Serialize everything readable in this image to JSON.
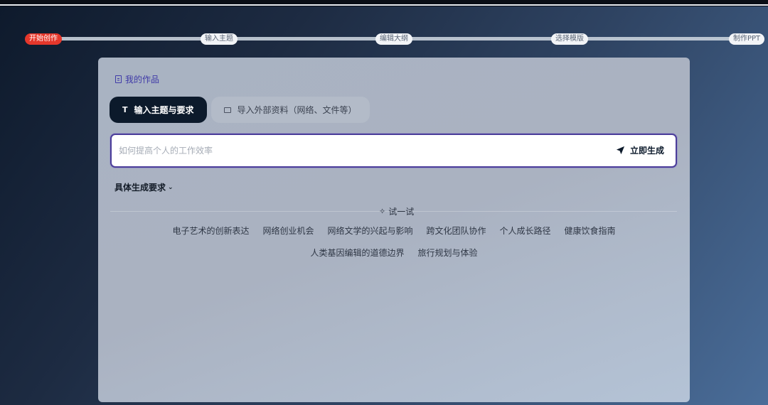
{
  "progress": {
    "steps": [
      "开始创作",
      "输入主题",
      "编辑大纲",
      "选择模版",
      "制作PPT"
    ],
    "active_index": 0
  },
  "card": {
    "my_works": "我的作品",
    "tabs": [
      {
        "label": "输入主题与要求",
        "icon": "text-icon"
      },
      {
        "label": "导入外部资料（网络、文件等）",
        "icon": "folder-icon"
      }
    ],
    "input": {
      "placeholder": "如何提高个人的工作效率",
      "value": ""
    },
    "generate_label": "立即生成",
    "requirements_label": "具体生成要求",
    "try_label": "试一试",
    "suggestions": [
      "电子艺术的创新表达",
      "网络创业机会",
      "网络文学的兴起与影响",
      "跨文化团队协作",
      "个人成长路径",
      "健康饮食指南",
      "人类基因编辑的道德边界",
      "旅行规划与体验"
    ]
  },
  "colors": {
    "accent_red": "#e5372b",
    "dark": "#0c1a2b",
    "input_border": "#4b3d9a",
    "link_purple": "#3f3aa8"
  }
}
